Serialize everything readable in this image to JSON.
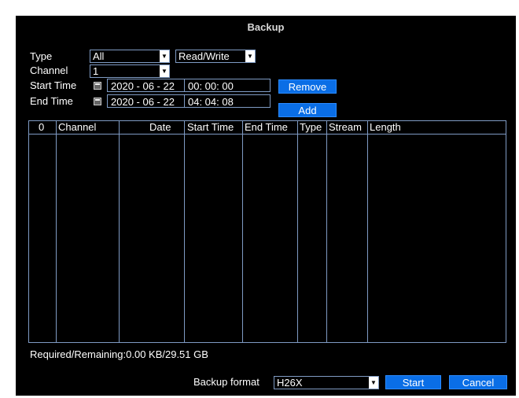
{
  "window": {
    "title": "Backup"
  },
  "form": {
    "type_label": "Type",
    "type_value": "All",
    "rw_value": "Read/Write",
    "channel_label": "Channel",
    "channel_value": "1",
    "start_label": "Start Time",
    "start_date": "2020 - 06 - 22",
    "start_time": "00: 00: 00",
    "end_label": "End Time",
    "end_date": "2020 - 06 - 22",
    "end_time": "04: 04: 08",
    "remove_label": "Remove",
    "add_label": "Add"
  },
  "table": {
    "columns": [
      "0",
      "Channel",
      "Date",
      "Start Time",
      "End Time",
      "Type",
      "Stream",
      "Length"
    ],
    "rows": []
  },
  "footer": {
    "required_remaining": "Required/Remaining:0.00 KB/29.51 GB",
    "format_label": "Backup format",
    "format_value": "H26X",
    "start_label": "Start",
    "cancel_label": "Cancel"
  },
  "colors": {
    "background": "#000000",
    "accent": "#0a6ee6",
    "border": "#7f9bc4",
    "text": "#ffffff"
  },
  "icons": {
    "calendar": "calendar-icon",
    "dropdown": "chevron-down-icon"
  }
}
